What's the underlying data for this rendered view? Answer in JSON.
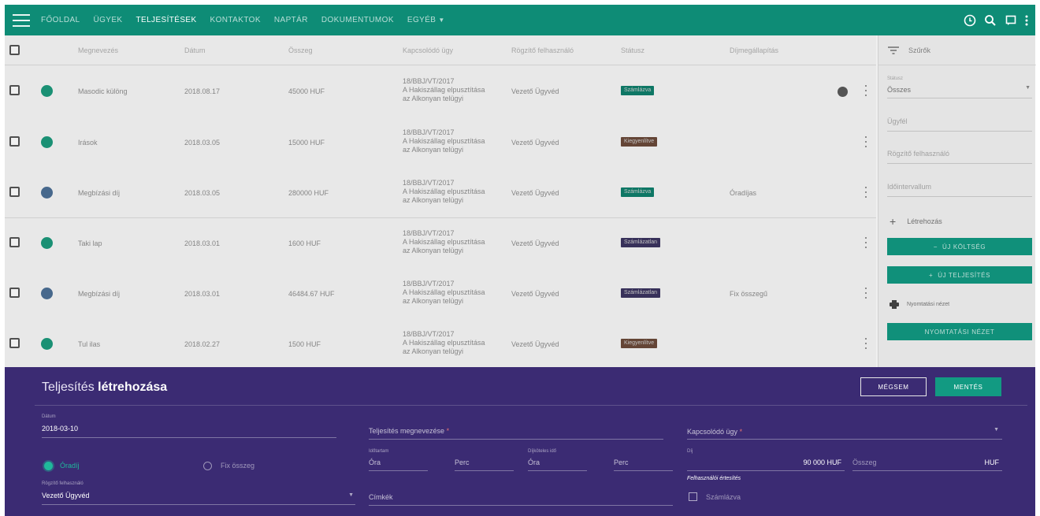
{
  "nav": {
    "items": [
      "FŐOLDAL",
      "ÜGYEK",
      "TELJESÍTÉSEK",
      "KONTAKTOK",
      "NAPTÁR",
      "DOKUMENTUMOK"
    ],
    "more_label": "EGYÉB"
  },
  "table": {
    "headers": [
      "Megnevezés",
      "Dátum",
      "Összeg",
      "Kapcsolódó ügy",
      "Rögzítő felhasználó",
      "Státusz",
      "Díjmegállapítás"
    ],
    "rows": [
      {
        "name": "Masodic különg",
        "date": "2018.08.17",
        "amount": "45000 HUF",
        "case": [
          "18/BBJ/VT/2017",
          "A Hakiszállag elpusztítása",
          "az Alkonyan telügyi"
        ],
        "user": "Vezető Ügyvéd",
        "status": "Számlázva",
        "status_color": "#0f7f6c",
        "fee": "",
        "dot": "#1c9a7c"
      },
      {
        "name": "Irások",
        "date": "2018.03.05",
        "amount": "15000 HUF",
        "case": [
          "18/BBJ/VT/2017",
          "A Hakiszállag elpusztítása",
          "az Alkonyan telügyi"
        ],
        "user": "Vezető Ügyvéd",
        "status": "Kiegyenlítve",
        "status_color": "#6b4a3a",
        "fee": "",
        "dot": "#1c9a7c"
      },
      {
        "name": "Megbízási díj",
        "date": "2018.03.05",
        "amount": "280000 HUF",
        "case": [
          "18/BBJ/VT/2017",
          "A Hakiszállag elpusztítása",
          "az Alkonyan telügyi"
        ],
        "user": "Vezető Ügyvéd",
        "status": "Számlázva",
        "status_color": "#0f7f6c",
        "fee": "Óradíjas",
        "dot": "#4c6f95"
      },
      {
        "name": "Taki lap",
        "date": "2018.03.01",
        "amount": "1600 HUF",
        "case": [
          "18/BBJ/VT/2017",
          "A Hakiszállag elpusztítása",
          "az Alkonyan telügyi"
        ],
        "user": "Vezető Ügyvéd",
        "status": "Számlázatlan",
        "status_color": "#3c3560",
        "fee": "",
        "dot": "#1c9a7c"
      },
      {
        "name": "Megbízási díj",
        "date": "2018.03.01",
        "amount": "46484.67 HUF",
        "case": [
          "18/BBJ/VT/2017",
          "A Hakiszállag elpusztítása",
          "az Alkonyan telügyi"
        ],
        "user": "Vezető Ügyvéd",
        "status": "Számlázatlan",
        "status_color": "#3c3560",
        "fee": "Fix összegű",
        "dot": "#4c6f95"
      },
      {
        "name": "Tul ilas",
        "date": "2018.02.27",
        "amount": "1500 HUF",
        "case": [
          "18/BBJ/VT/2017",
          "A Hakiszállag elpusztítása",
          "az Alkonyan telügyi"
        ],
        "user": "Vezető Ügyvéd",
        "status": "Kiegyenlítve",
        "status_color": "#6b4a3a",
        "fee": "",
        "dot": "#1c9a7c"
      }
    ]
  },
  "side": {
    "filter_label": "Szűrők",
    "status_label": "Státusz",
    "status_value": "Összes",
    "field1": "Ügyfél",
    "field2": "Rögzítő felhasználó",
    "field3": "Időintervallum",
    "create_label": "Létrehozás",
    "btn_new_cost": "ÚJ KÖLTSÉG",
    "btn_new_fulfil": "ÚJ TELJESÍTÉS",
    "print_label": "Nyomtatási nézet",
    "btn_print": "NYOMTATÁSI NÉZET"
  },
  "form": {
    "title_prefix": "Teljesítés",
    "title_bold": "létrehozása",
    "cancel_label": "MÉGSEM",
    "save_label": "MENTÉS",
    "date_label": "Dátum",
    "date_value": "2018-03-10",
    "name_placeholder": "Teljesítés megnevezése",
    "case_placeholder": "Kapcsolódó ügy",
    "radio_hourly": "Óradíj",
    "radio_fixed": "Fix összeg",
    "hours_label1": "Időtartam",
    "hours_label2": "Díjköteles idő",
    "hour_ph": "Óra",
    "min_ph": "Perc",
    "fee_label": "Díj",
    "fee_value": "90 000 HUF",
    "amount_ph": "Összeg",
    "currency": "HUF",
    "user_label": "Rögzítő felhasználó",
    "user_value": "Vezető Ügyvéd",
    "tags_ph": "Címkék",
    "billable_title": "Felhasználói értesítés",
    "billable_label": "Számlázva"
  },
  "colors": {
    "primary": "#0e8c76",
    "accent": "#129a82",
    "form_bg": "#3b2b73"
  }
}
